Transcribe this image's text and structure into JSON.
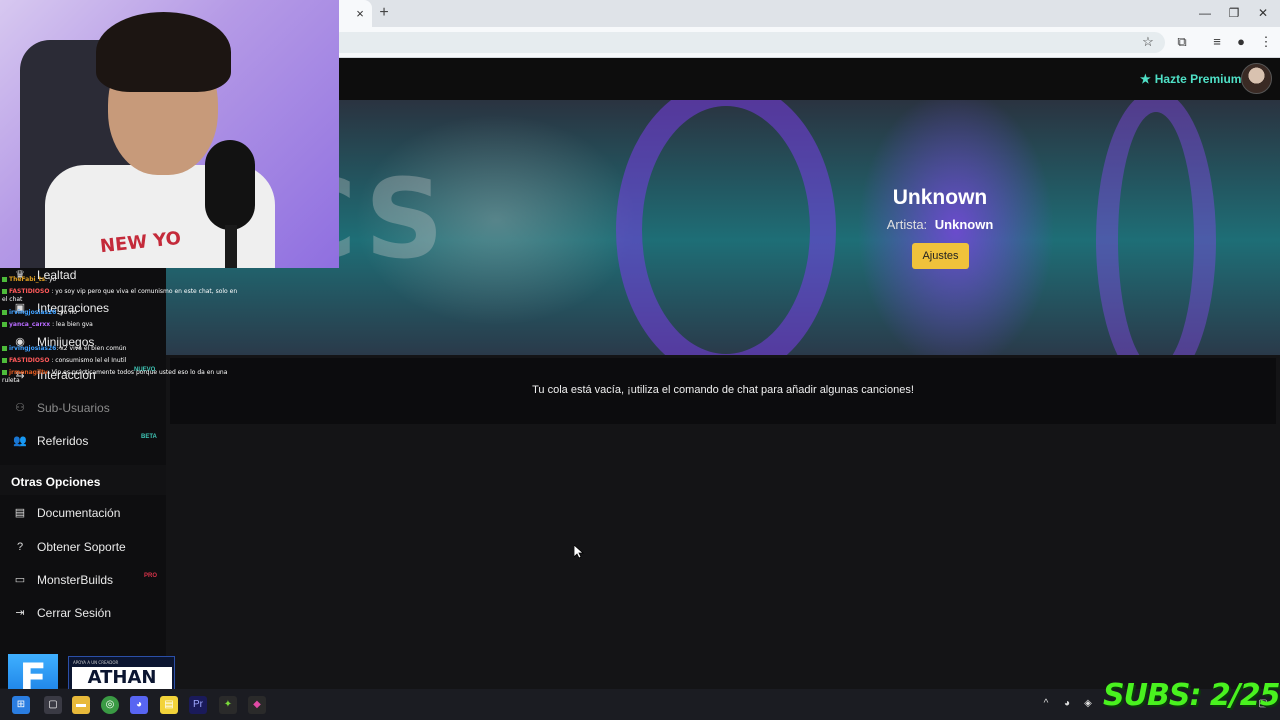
{
  "browser": {
    "tab_close": "×",
    "new_tab": "+",
    "window_controls": {
      "minimize": "—",
      "restore": "❐",
      "close": "✕"
    },
    "toolbar_icons": [
      "star-icon",
      "extensions-icon",
      "media-icon",
      "profile-icon",
      "menu-icon"
    ]
  },
  "header": {
    "premium_label": "Hazte Premium"
  },
  "hero": {
    "song_title": "Unknown",
    "artist_label": "Artista:",
    "artist_value": "Unknown",
    "settings_button": "Ajustes"
  },
  "queue": {
    "empty_message": "Tu cola está vacía, ¡utiliza el comando de chat para añadir algunas canciones!"
  },
  "sidebar": {
    "items": [
      {
        "label": "Lealtad",
        "icon": "trophy-icon"
      },
      {
        "label": "Integraciones",
        "icon": "puzzle-icon"
      },
      {
        "label": "Minijuegos",
        "icon": "gamepad-icon",
        "badge": "NUEVO"
      },
      {
        "label": "Interacción",
        "icon": "interaction-icon"
      },
      {
        "label": "Sub-Usuarios",
        "icon": "users-icon"
      },
      {
        "label": "Referidos",
        "icon": "user-group-icon",
        "badge": "BETA"
      }
    ],
    "other_heading": "Otras Opciones",
    "other_items": [
      {
        "label": "Documentación",
        "icon": "book-icon"
      },
      {
        "label": "Obtener Soporte",
        "icon": "question-icon"
      },
      {
        "label": "MonsterBuilds",
        "icon": "laptop-icon",
        "badge": "PRO"
      },
      {
        "label": "Cerrar Sesión",
        "icon": "logout-icon"
      }
    ]
  },
  "chat": [
    {
      "user": "TheFabi_ts",
      "text": ": yo"
    },
    {
      "user": "FASTIDIOSO",
      "text": ": yo soy vip pero que viva el comunismo en este chat, solo en el chat"
    },
    {
      "user": "irvingjosias26",
      "text": ": yo no"
    },
    {
      "user": "yanca_carxx",
      "text": ": lea bien gva"
    },
    {
      "user": "",
      "text": ""
    },
    {
      "user": "irvingjosias26",
      "text": ": x2 viva el bien común"
    },
    {
      "user": "FASTIDIOSO",
      "text": ": consumismo lel el Inutil"
    },
    {
      "user": "jrmenagiltv",
      "text": ": Vip es prácticamente todos porque usted eso lo da en una ruleta"
    }
  ],
  "overlays": {
    "fortnite_letter": "F",
    "creator_small": "APOYA A UN CREADOR",
    "creator_name": "ATHAN",
    "subs_text": "SUBS: 2/25",
    "webcam_shirt_text": "NEW YO"
  },
  "colors": {
    "accent_teal": "#4fe0c6",
    "button_yellow": "#f0c23b",
    "badge_beta": "#3fc6b6",
    "badge_pro": "#d8334a",
    "badge_new": "#3fc6b6",
    "subs_green": "#49f21f"
  }
}
